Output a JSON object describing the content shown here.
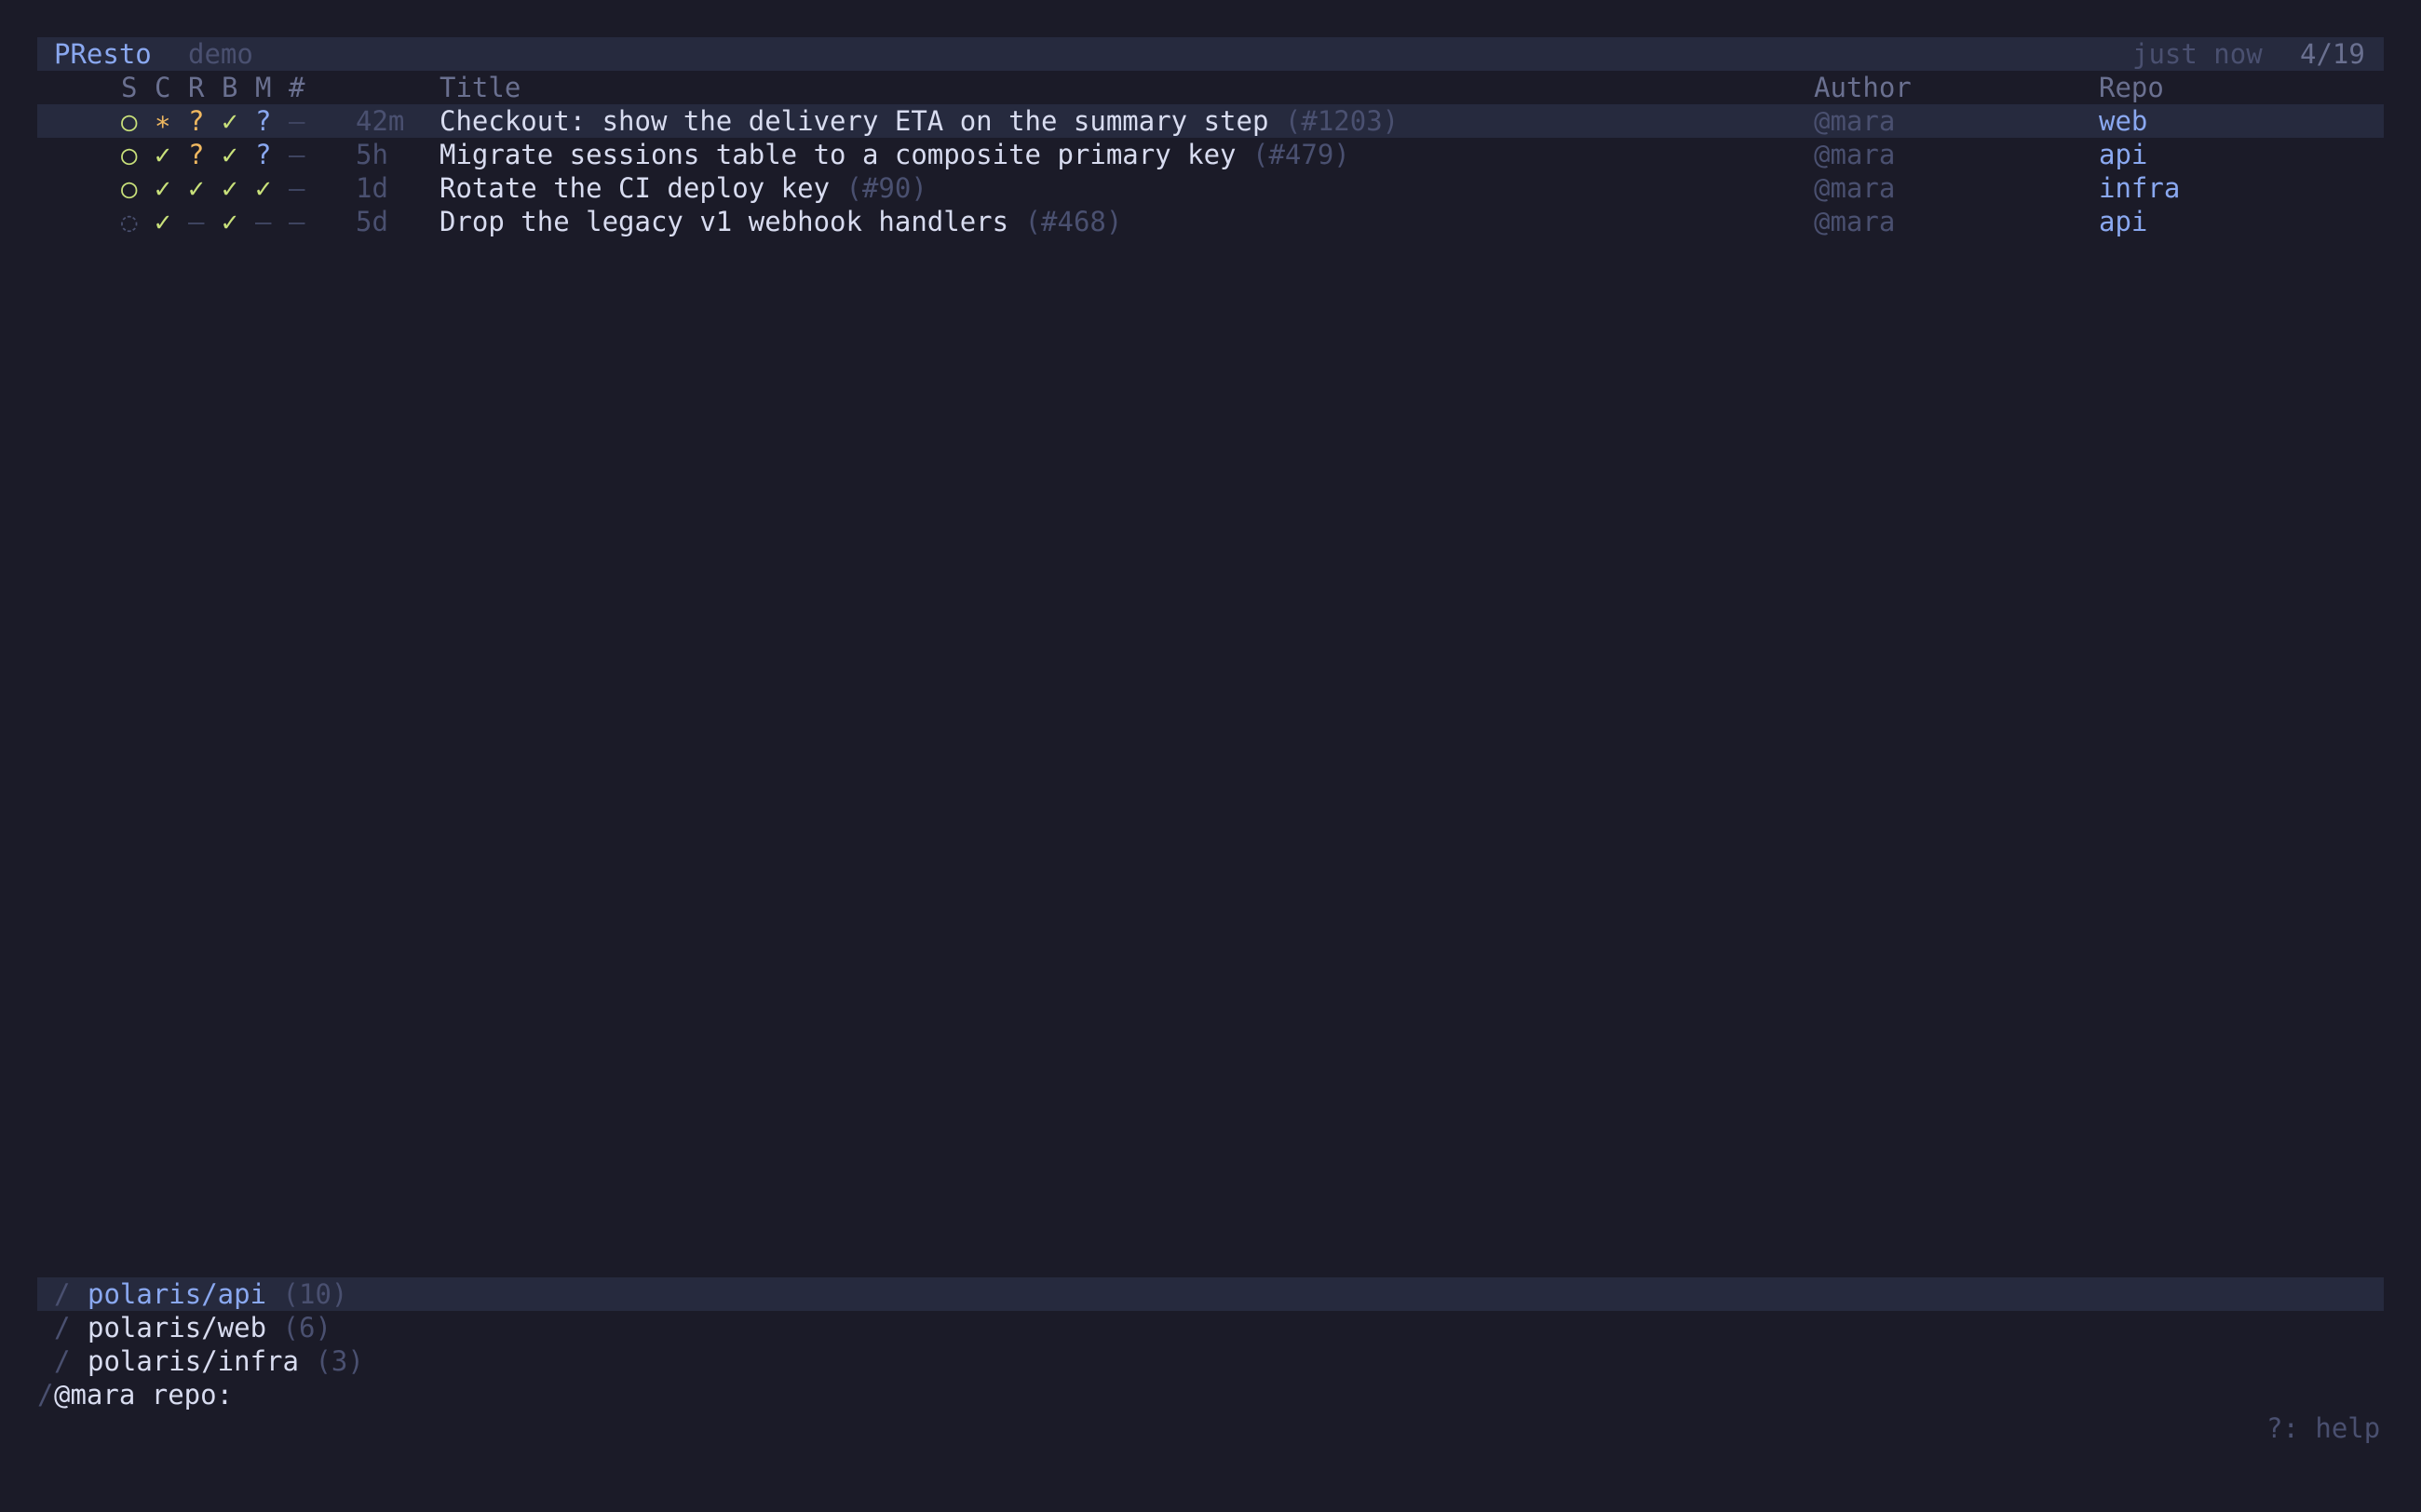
{
  "header": {
    "app_name": "PResto",
    "mode": "demo",
    "updated": "just now",
    "count": "4/19"
  },
  "columns": {
    "s": "S",
    "c": "C",
    "r": "R",
    "b": "B",
    "m": "M",
    "num": "#",
    "title": "Title",
    "author": "Author",
    "repo": "Repo"
  },
  "rows": [
    {
      "s": "○",
      "c": "∗",
      "r": "?",
      "b": "✓",
      "m": "?",
      "num": "–",
      "age": "42m",
      "title": "Checkout: show the delivery ETA on the summary step",
      "pr": "(#1203)",
      "author": "@mara",
      "repo": "web",
      "colors": {
        "s": "#c8e07a",
        "c": "#f0b860",
        "r": "#f0b860",
        "b": "#c8e07a",
        "m": "#8aa8f0",
        "num": "#3e4460"
      }
    },
    {
      "s": "○",
      "c": "✓",
      "r": "?",
      "b": "✓",
      "m": "?",
      "num": "–",
      "age": "5h",
      "title": "Migrate sessions table to a composite primary key",
      "pr": "(#479)",
      "author": "@mara",
      "repo": "api",
      "colors": {
        "s": "#c8e07a",
        "c": "#c8e07a",
        "r": "#f0b860",
        "b": "#c8e07a",
        "m": "#8aa8f0",
        "num": "#3e4460"
      }
    },
    {
      "s": "○",
      "c": "✓",
      "r": "✓",
      "b": "✓",
      "m": "✓",
      "num": "–",
      "age": "1d",
      "title": "Rotate the CI deploy key",
      "pr": "(#90)",
      "author": "@mara",
      "repo": "infra",
      "colors": {
        "s": "#c8e07a",
        "c": "#c8e07a",
        "r": "#c8e07a",
        "b": "#c8e07a",
        "m": "#c8e07a",
        "num": "#3e4460"
      }
    },
    {
      "s": "◌",
      "c": "✓",
      "r": "–",
      "b": "✓",
      "m": "–",
      "num": "–",
      "age": "5d",
      "title": "Drop the legacy v1 webhook handlers",
      "pr": "(#468)",
      "author": "@mara",
      "repo": "api",
      "colors": {
        "s": "#4a5070",
        "c": "#c8e07a",
        "r": "#3e4460",
        "b": "#c8e07a",
        "m": "#3e4460",
        "num": "#3e4460"
      }
    }
  ],
  "suggestions": [
    {
      "prefix": "/",
      "name": "polaris/api",
      "count": "(10)"
    },
    {
      "prefix": "/",
      "name": "polaris/web",
      "count": "(6)"
    },
    {
      "prefix": "/",
      "name": "polaris/infra",
      "count": "(3)"
    }
  ],
  "prompt": {
    "slash": "/",
    "text": "@mara repo:"
  },
  "footer": {
    "help": "?: help"
  },
  "colors": {
    "background": "#1b1b28",
    "highlight": "#262a3e",
    "accent_blue": "#8aa8f0",
    "ok_green": "#c8e07a",
    "warn_orange": "#f0b860",
    "dim": "#4a5070"
  }
}
